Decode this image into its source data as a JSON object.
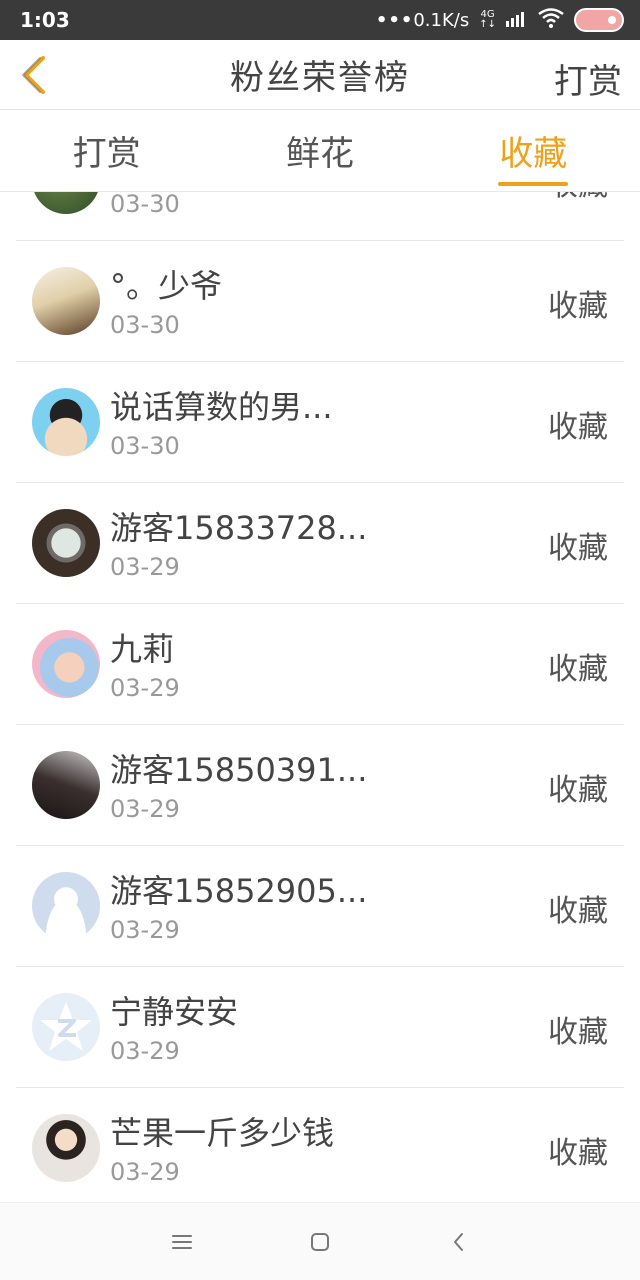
{
  "status": {
    "time": "1:03",
    "net_speed": "0.1K/s",
    "net_dots": "•••",
    "net_type_top": "4G",
    "net_type_bottom": "↑↓"
  },
  "header": {
    "title": "粉丝荣誉榜",
    "right_label": "打赏"
  },
  "tabs": [
    {
      "label": "打赏",
      "active": false
    },
    {
      "label": "鲜花",
      "active": false
    },
    {
      "label": "收藏",
      "active": true
    }
  ],
  "colors": {
    "accent": "#f0a11c",
    "status_bar": "#3a3a3a"
  },
  "fans": [
    {
      "name": "",
      "date": "03-30",
      "action": "收藏"
    },
    {
      "name": "°。少爷",
      "date": "03-30",
      "action": "收藏"
    },
    {
      "name": "说话算数的男...",
      "date": "03-30",
      "action": "收藏"
    },
    {
      "name": "游客15833728...",
      "date": "03-29",
      "action": "收藏"
    },
    {
      "name": "九莉",
      "date": "03-29",
      "action": "收藏"
    },
    {
      "name": "游客15850391...",
      "date": "03-29",
      "action": "收藏"
    },
    {
      "name": "游客15852905...",
      "date": "03-29",
      "action": "收藏"
    },
    {
      "name": "宁静安安",
      "date": "03-29",
      "action": "收藏"
    },
    {
      "name": "芒果一斤多少钱",
      "date": "03-29",
      "action": "收藏"
    }
  ]
}
